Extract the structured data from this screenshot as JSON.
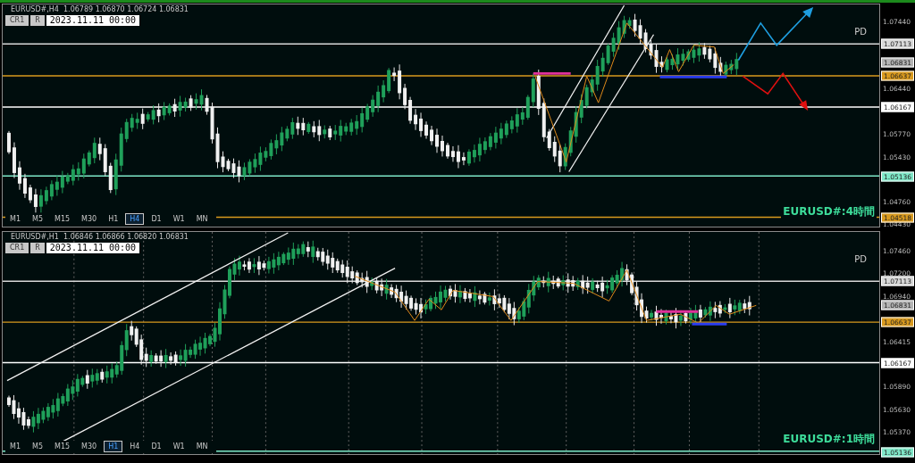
{
  "panels": [
    {
      "symbol_line": "EURUSD#,H4  1.06789 1.06870 1.06724 1.06831",
      "buttons": [
        "CR1",
        "R"
      ],
      "date_field": "2023.11.11 00:00",
      "corner_label": "PD",
      "title_label": "EURUSD#:4時間",
      "axis_ticks": [
        "1.07440",
        "1.06440",
        "1.05770",
        "1.05430",
        "1.04760",
        "1.04430"
      ],
      "price_tags": [
        {
          "label": "1.07113",
          "kind": "line",
          "color": "#d8d8d8"
        },
        {
          "label": "1.06831",
          "kind": "bid",
          "color": "#b4b4b4"
        },
        {
          "label": "1.06637",
          "kind": "line",
          "color": "#d99a1e"
        },
        {
          "label": "1.06167",
          "kind": "line",
          "color": "#ffffff"
        },
        {
          "label": "1.05136",
          "kind": "line",
          "color": "#7fe8c8"
        },
        {
          "label": "1.04518",
          "kind": "line",
          "color": "#d99a1e"
        }
      ],
      "timeframes": [
        {
          "label": "M1",
          "selected": false
        },
        {
          "label": "M5",
          "selected": false
        },
        {
          "label": "M15",
          "selected": false
        },
        {
          "label": "M30",
          "selected": false
        },
        {
          "label": "H1",
          "selected": false
        },
        {
          "label": "H4",
          "selected": true
        },
        {
          "label": "D1",
          "selected": false
        },
        {
          "label": "W1",
          "selected": false
        },
        {
          "label": "MN",
          "selected": false
        }
      ]
    },
    {
      "symbol_line": "EURUSD#,H1  1.06846 1.06866 1.06820 1.06831",
      "buttons": [
        "CR1",
        "R"
      ],
      "date_field": "2023.11.11 00:00",
      "corner_label": "PD",
      "title_label": "EURUSD#:1時間",
      "axis_ticks": [
        "1.07460",
        "1.07200",
        "1.06940",
        "1.06415",
        "1.05890",
        "1.05630",
        "1.05370"
      ],
      "price_tags": [
        {
          "label": "1.07113",
          "kind": "line",
          "color": "#d8d8d8"
        },
        {
          "label": "1.06831",
          "kind": "bid",
          "color": "#b4b4b4"
        },
        {
          "label": "1.06637",
          "kind": "line",
          "color": "#d99a1e"
        },
        {
          "label": "1.06167",
          "kind": "line",
          "color": "#ffffff"
        },
        {
          "label": "1.05136",
          "kind": "line",
          "color": "#7fe8c8"
        }
      ],
      "timeframes": [
        {
          "label": "M1",
          "selected": false
        },
        {
          "label": "M5",
          "selected": false
        },
        {
          "label": "M15",
          "selected": false
        },
        {
          "label": "M30",
          "selected": false
        },
        {
          "label": "H1",
          "selected": true
        },
        {
          "label": "H4",
          "selected": false
        },
        {
          "label": "D1",
          "selected": false
        },
        {
          "label": "W1",
          "selected": false
        },
        {
          "label": "MN",
          "selected": false
        }
      ]
    }
  ]
}
